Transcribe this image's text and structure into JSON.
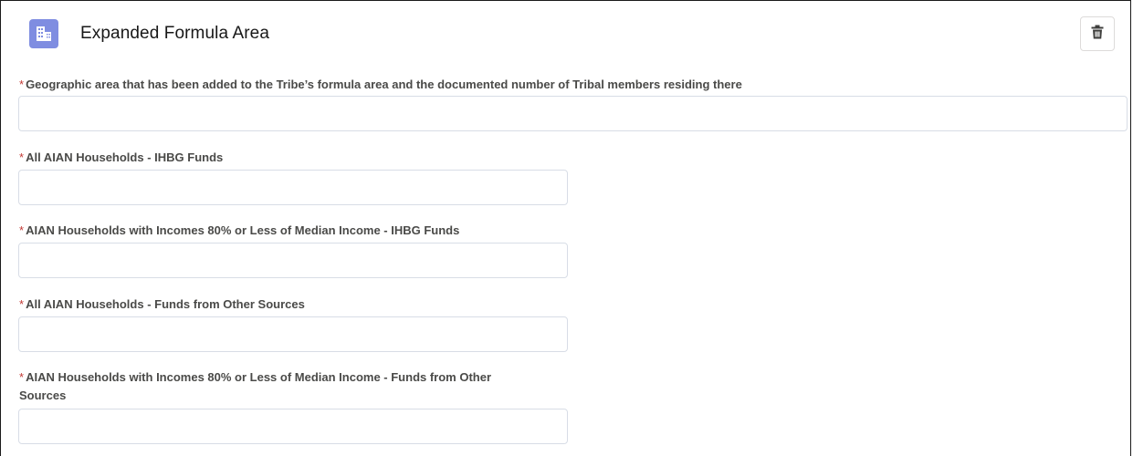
{
  "section": {
    "title": "Expanded Formula Area",
    "header_icon": "building-icon",
    "delete_icon": "trash-icon",
    "accent_color": "#7f8de1",
    "required_color": "#c23934"
  },
  "fields": [
    {
      "required_marker": "*",
      "label": "Geographic area that has been added to the Tribe’s formula area and the documented number of Tribal members residing there",
      "value": "",
      "placeholder": ""
    },
    {
      "required_marker": "*",
      "label": "All AIAN Households - IHBG Funds",
      "value": "",
      "placeholder": ""
    },
    {
      "required_marker": "*",
      "label": "AIAN Households with Incomes 80% or Less of Median Income - IHBG Funds",
      "value": "",
      "placeholder": ""
    },
    {
      "required_marker": "*",
      "label": "All AIAN Households - Funds from Other Sources",
      "value": "",
      "placeholder": ""
    },
    {
      "required_marker": "*",
      "label_line1": "AIAN Households with Incomes 80% or Less of Median Income - Funds from Other",
      "label_line2": "Sources",
      "value": "",
      "placeholder": ""
    }
  ]
}
